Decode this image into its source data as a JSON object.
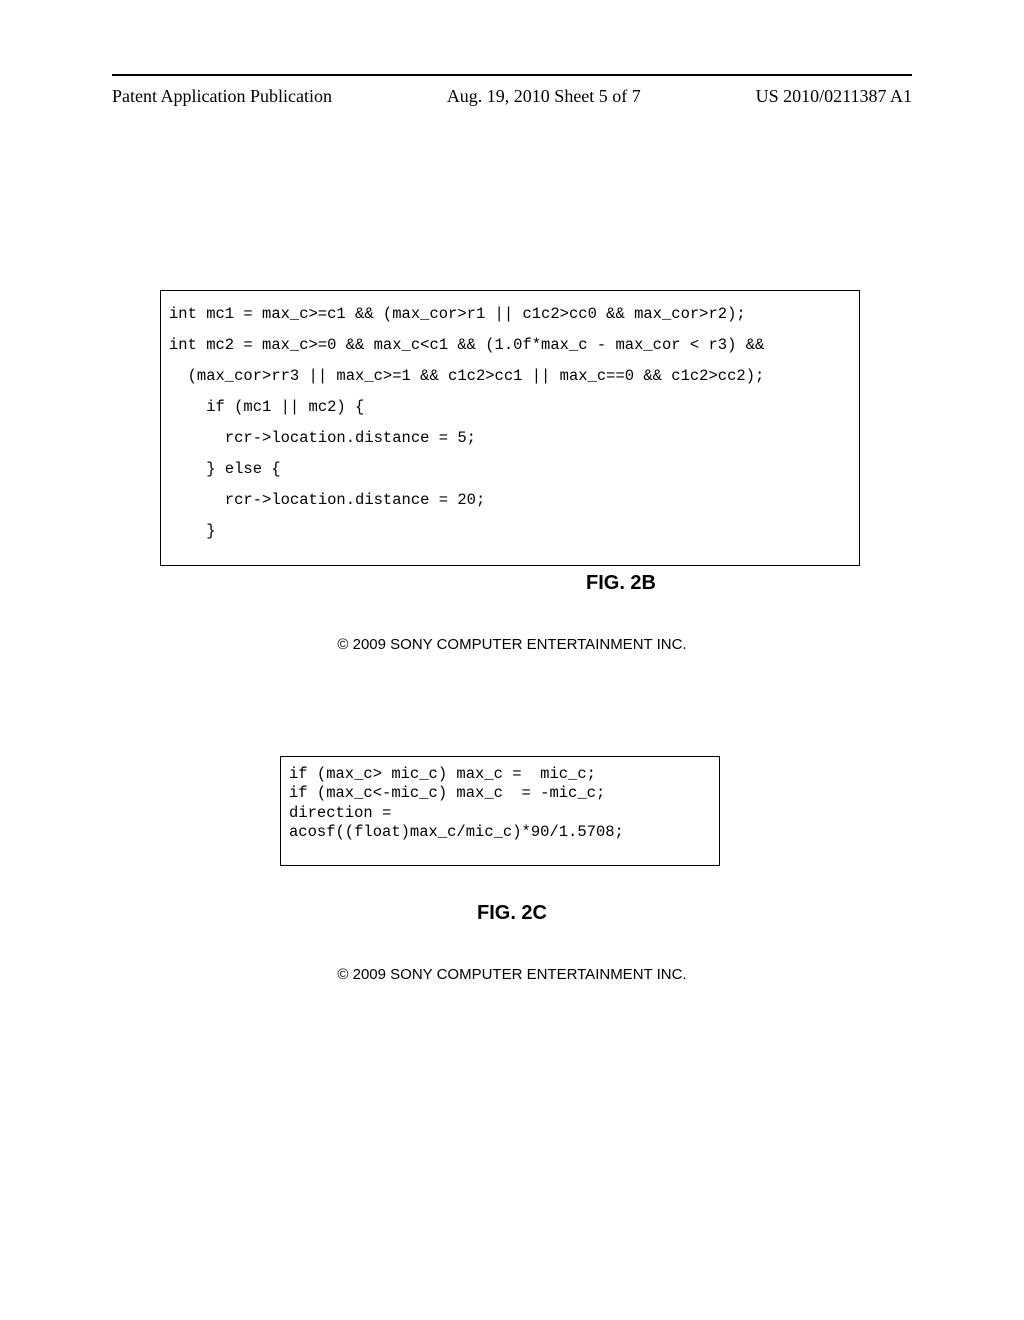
{
  "header": {
    "left": "Patent Application Publication",
    "center": "Aug. 19, 2010  Sheet 5 of 7",
    "right": "US 2010/0211387 A1"
  },
  "figure2b": {
    "code": "int mc1 = max_c>=c1 && (max_cor>r1 || c1c2>cc0 && max_cor>r2);\nint mc2 = max_c>=0 && max_c<c1 && (1.0f*max_c - max_cor < r3) &&\n  (max_cor>rr3 || max_c>=1 && c1c2>cc1 || max_c==0 && c1c2>cc2);\n    if (mc1 || mc2) {\n      rcr->location.distance = 5;\n    } else {\n      rcr->location.distance = 20;\n    }",
    "label": "FIG. 2B",
    "copyright": "© 2009  SONY COMPUTER ENTERTAINMENT INC."
  },
  "figure2c": {
    "code": "if (max_c> mic_c) max_c =  mic_c;\nif (max_c<-mic_c) max_c  = -mic_c;\ndirection =\nacosf((float)max_c/mic_c)*90/1.5708;",
    "label": "FIG. 2C",
    "copyright": "© 2009  SONY COMPUTER ENTERTAINMENT INC."
  }
}
